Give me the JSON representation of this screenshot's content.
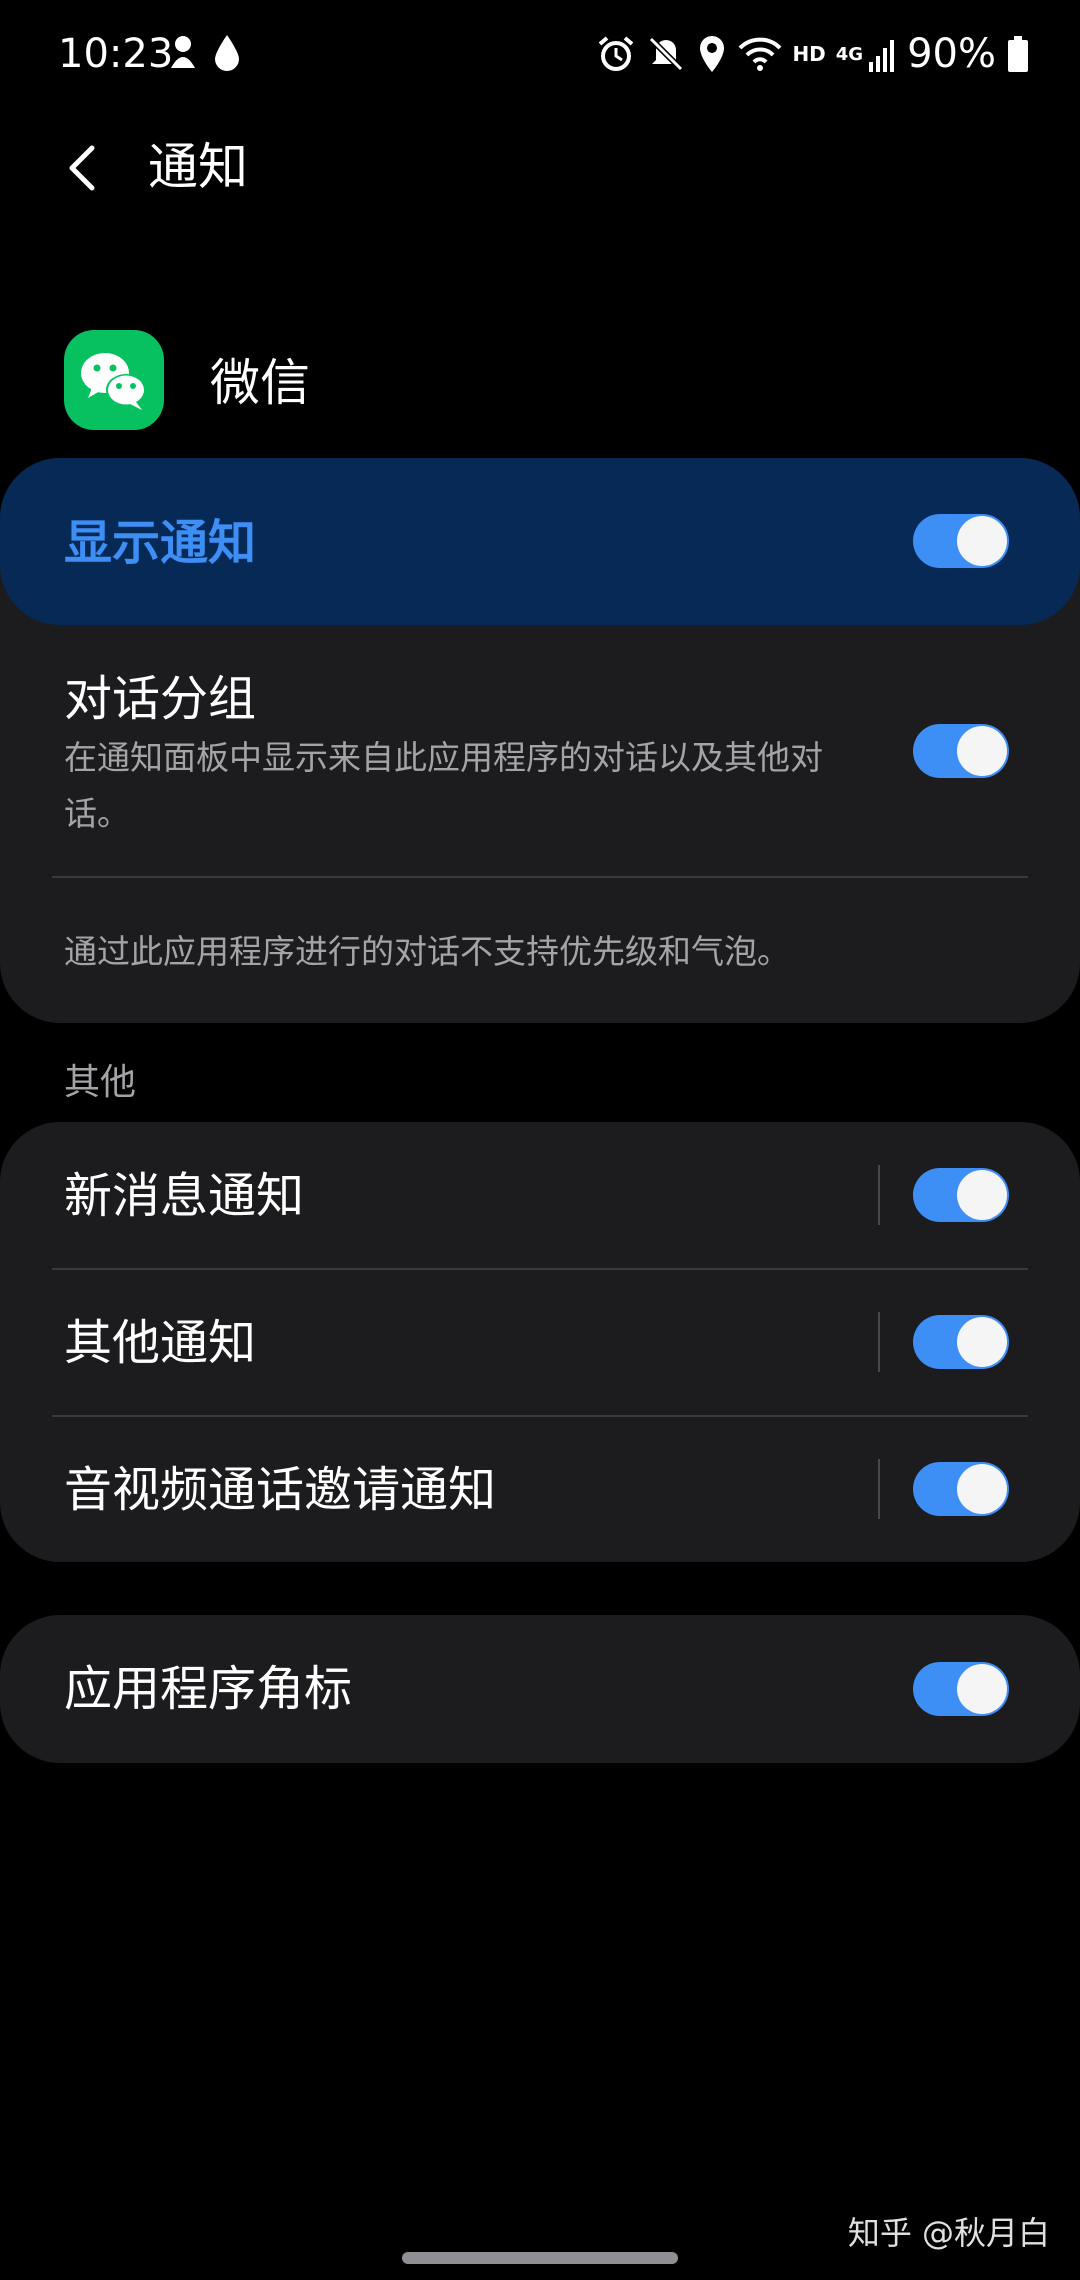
{
  "status_bar": {
    "time": "10:23",
    "battery": "90%",
    "network_label": "HD",
    "signal_label": "4G",
    "icons": [
      "alarm-icon",
      "mute-icon",
      "location-icon",
      "wifi-icon",
      "signal-icon",
      "battery-icon"
    ]
  },
  "header": {
    "title": "通知"
  },
  "app": {
    "name": "微信",
    "icon_color": "#07c160"
  },
  "show_notifications": {
    "label": "显示通知",
    "enabled": true
  },
  "conversation_group": {
    "title": "对话分组",
    "desc": "在通知面板中显示来自此应用程序的对话以及其他对话。",
    "enabled": true,
    "note": "通过此应用程序进行的对话不支持优先级和气泡。"
  },
  "other_section": {
    "label": "其他",
    "items": [
      {
        "label": "新消息通知",
        "enabled": true
      },
      {
        "label": "其他通知",
        "enabled": true
      },
      {
        "label": "音视频通话邀请通知",
        "enabled": true
      }
    ]
  },
  "badge": {
    "label": "应用程序角标",
    "enabled": true
  },
  "watermark": "知乎 @秋月白",
  "colors": {
    "accent": "#3d8ef5",
    "highlight_bg": "#062a55",
    "card_bg": "#1c1c1e"
  }
}
